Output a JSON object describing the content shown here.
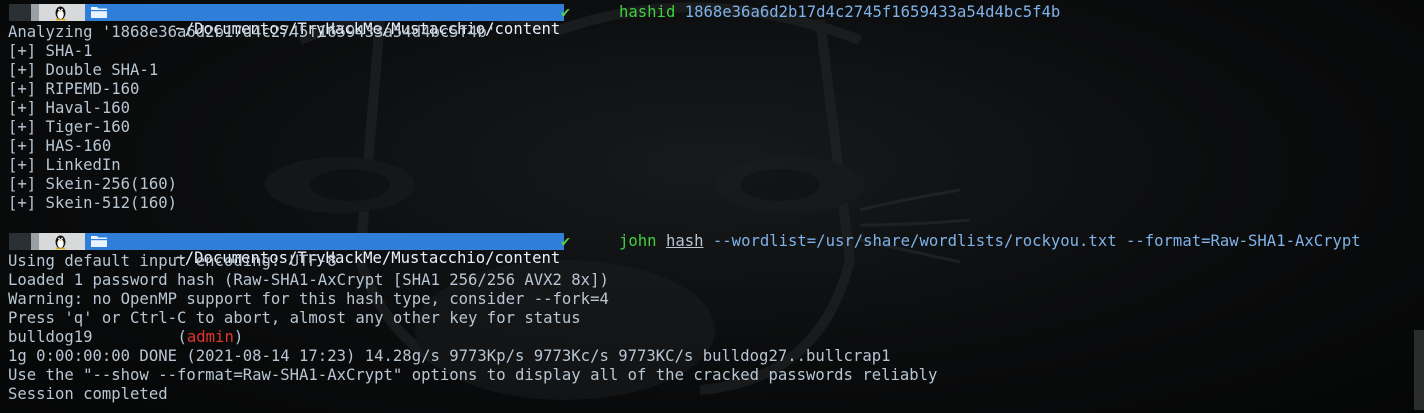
{
  "prompt": {
    "os_icon": "tux-linux-icon",
    "folder_icon": "folder-icon",
    "path": "~/Documentos/TryHackMe/Mustacchio/content",
    "status_icon": "check-icon",
    "status_glyph": "✔"
  },
  "block1": {
    "command": "hashid",
    "args": " 1868e36a6d2b17d4c2745f1659433a54d4bc5f4b",
    "output": [
      "Analyzing '1868e36a6d2b17d4c2745f1659433a54d4bc5f4b'",
      "[+] SHA-1",
      "[+] Double SHA-1",
      "[+] RIPEMD-160",
      "[+] Haval-160",
      "[+] Tiger-160",
      "[+] HAS-160",
      "[+] LinkedIn",
      "[+] Skein-256(160)",
      "[+] Skein-512(160)"
    ]
  },
  "block2": {
    "command": "john",
    "arg_file": "hash",
    "args": " --wordlist=/usr/share/wordlists/rockyou.txt --format=Raw-SHA1-AxCrypt",
    "output": [
      "Using default input encoding: UTF-8",
      "Loaded 1 password hash (Raw-SHA1-AxCrypt [SHA1 256/256 AVX2 8x])",
      "Warning: no OpenMP support for this hash type, consider --fork=4",
      "Press 'q' or Ctrl-C to abort, almost any other key for status"
    ],
    "cracked_password": "bulldog19",
    "cracked_user_open": "(",
    "cracked_user": "admin",
    "cracked_user_close": ")",
    "output_after": [
      "1g 0:00:00:00 DONE (2021-08-14 17:23) 14.28g/s 9773Kp/s 9773Kc/s 9773KC/s bulldog27..bullcrap1",
      "Use the \"--show --format=Raw-SHA1-AxCrypt\" options to display all of the cracked passwords reliably",
      "Session completed"
    ]
  },
  "colors": {
    "text": "#b8c6d3",
    "path_bg": "#2f7fd8",
    "command": "#3fd13f",
    "check": "#55d24a",
    "highlight_red": "#e0342c"
  }
}
